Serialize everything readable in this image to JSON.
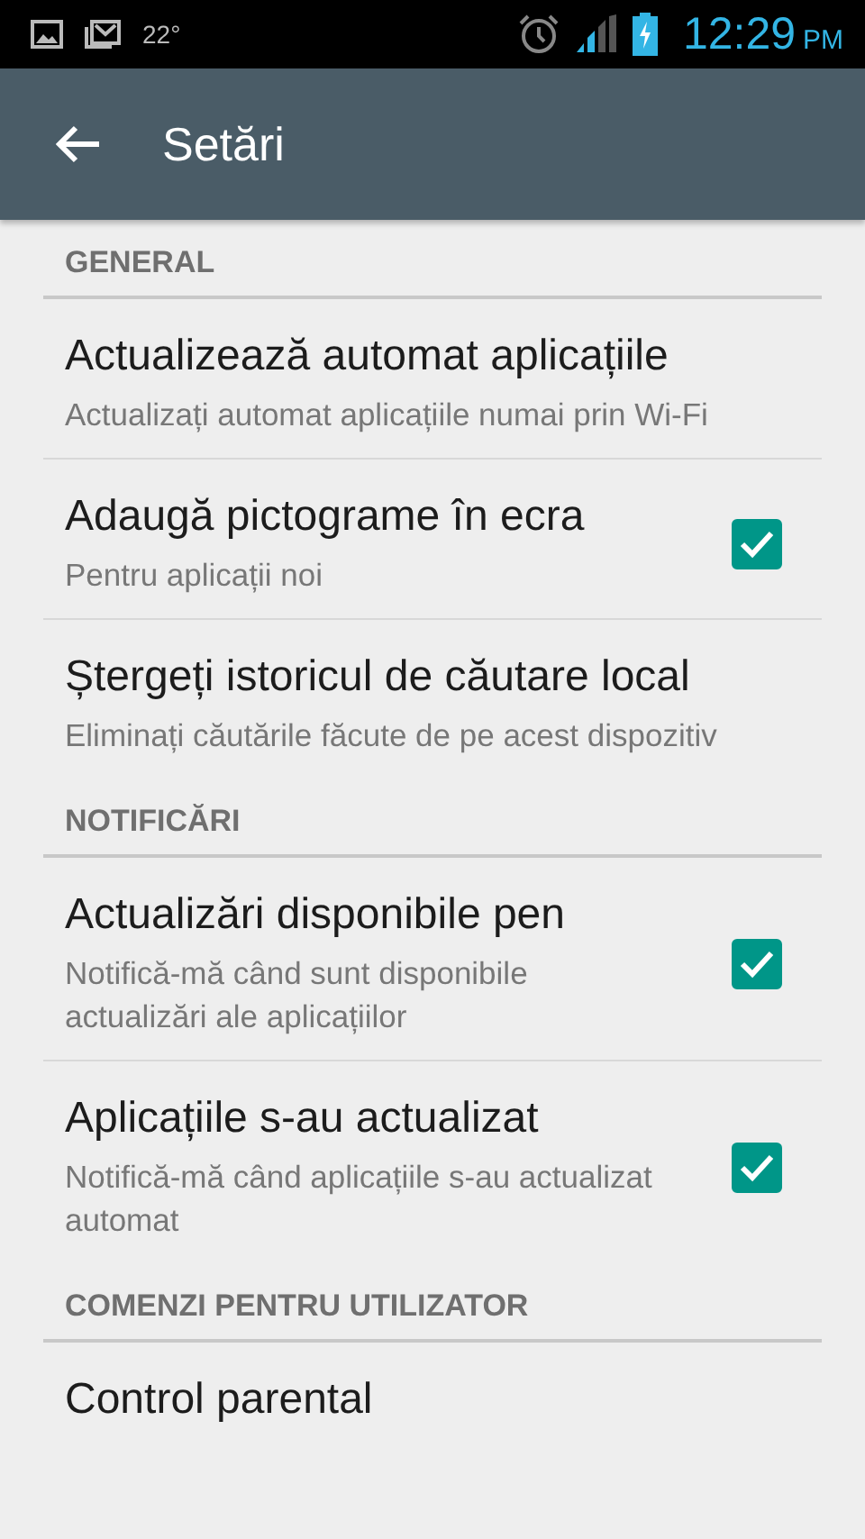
{
  "status_bar": {
    "temperature": "22°",
    "time": "12:29",
    "ampm": "PM"
  },
  "app_bar": {
    "title": "Setări"
  },
  "sections": [
    {
      "header": "GENERAL",
      "items": [
        {
          "kind": "plain",
          "title": "Actualizează automat aplicațiile",
          "subtitle": "Actualizați automat aplicațiile numai prin Wi-Fi"
        },
        {
          "kind": "checkbox",
          "title": "Adaugă pictograme în ecra",
          "subtitle": "Pentru aplicații noi",
          "checked": true
        },
        {
          "kind": "plain",
          "title": "Ștergeți istoricul de căutare local",
          "subtitle": "Eliminați căutările făcute de pe acest dispozitiv"
        }
      ]
    },
    {
      "header": "NOTIFICĂRI",
      "items": [
        {
          "kind": "checkbox",
          "title": "Actualizări disponibile pen",
          "subtitle": "Notifică-mă când sunt disponibile actualizări ale aplicațiilor",
          "checked": true
        },
        {
          "kind": "checkbox",
          "title": "Aplicațiile s-au actualizat",
          "subtitle": "Notifică-mă când aplicațiile s-au actualizat automat",
          "checked": true
        }
      ]
    },
    {
      "header": "COMENZI PENTRU UTILIZATOR",
      "items": [
        {
          "kind": "plain",
          "title": "Control parental"
        }
      ]
    }
  ]
}
